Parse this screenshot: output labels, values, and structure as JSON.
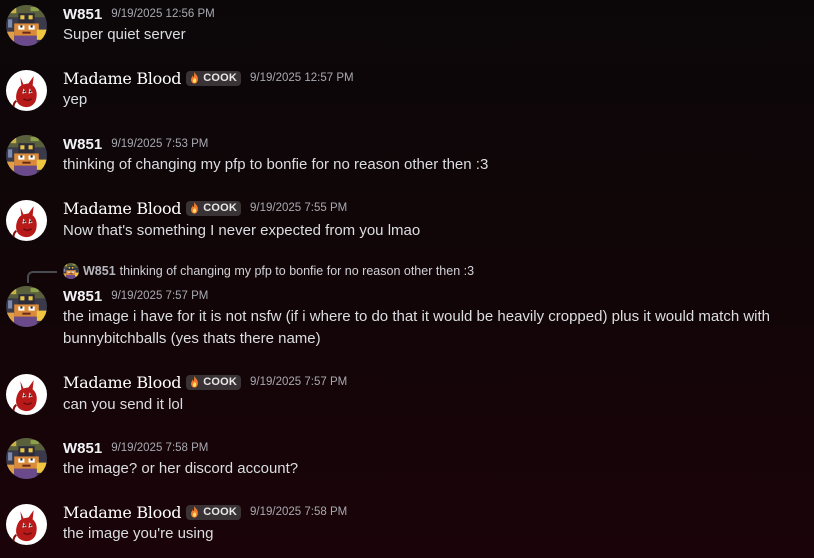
{
  "colors": {
    "background_top": "#0b0709",
    "background_bottom": "#1a0409",
    "username_text": "#f2f3f5",
    "timestamp_text": "#a8a9b0",
    "tag_background": "#3a3335"
  },
  "messages": [
    {
      "author": "W851",
      "avatar_icon": "pixel-art-avatar-icon",
      "timestamp": "9/19/2025 12:56 PM",
      "text": "Super quiet server"
    },
    {
      "author": "Madame Blood",
      "avatar_icon": "red-creature-avatar-icon",
      "tag": "COOK",
      "tag_icon": "flame-icon",
      "timestamp": "9/19/2025 12:57 PM",
      "text": "yep"
    },
    {
      "author": "W851",
      "avatar_icon": "pixel-art-avatar-icon",
      "timestamp": "9/19/2025 7:53 PM",
      "text": "thinking of changing my pfp to bonfie for no reason other then :3"
    },
    {
      "author": "Madame Blood",
      "avatar_icon": "red-creature-avatar-icon",
      "tag": "COOK",
      "tag_icon": "flame-icon",
      "timestamp": "9/19/2025 7:55 PM",
      "text": "Now that's something I never expected from you lmao"
    },
    {
      "author": "W851",
      "avatar_icon": "pixel-art-avatar-icon",
      "timestamp": "9/19/2025 7:57 PM",
      "reply": {
        "author": "W851",
        "text": "thinking of changing my pfp to bonfie for no reason other then :3"
      },
      "text": "the image i have for it is not nsfw (if i where to do that it would be heavily cropped) plus it would match with bunnybitchballs (yes thats there name)"
    },
    {
      "author": "Madame Blood",
      "avatar_icon": "red-creature-avatar-icon",
      "tag": "COOK",
      "tag_icon": "flame-icon",
      "timestamp": "9/19/2025 7:57 PM",
      "text": "can you send it lol"
    },
    {
      "author": "W851",
      "avatar_icon": "pixel-art-avatar-icon",
      "timestamp": "9/19/2025 7:58 PM",
      "text": "the image? or her discord account?"
    },
    {
      "author": "Madame Blood",
      "avatar_icon": "red-creature-avatar-icon",
      "tag": "COOK",
      "tag_icon": "flame-icon",
      "timestamp": "9/19/2025 7:58 PM",
      "text": "the image you're using"
    }
  ]
}
